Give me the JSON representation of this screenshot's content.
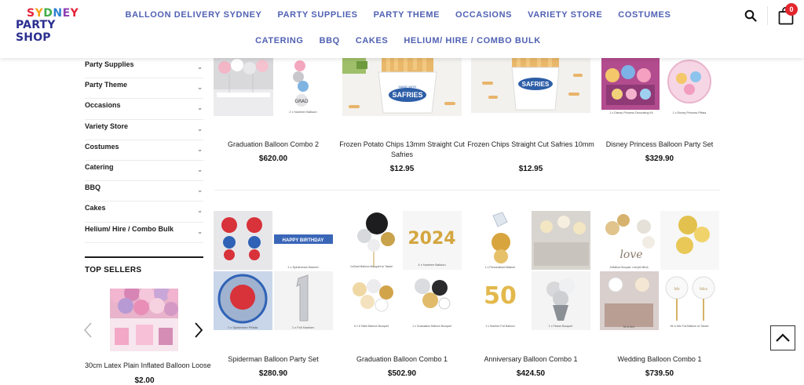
{
  "brand": {
    "line1_letters": [
      "S",
      "Y",
      "D",
      "N",
      "E",
      "Y"
    ],
    "line2": "PARTY SHOP"
  },
  "nav": {
    "items": [
      "Balloon Delivery Sydney",
      "Party Supplies",
      "Party Theme",
      "Occasions",
      "Variety Store",
      "Costumes",
      "Catering",
      "BBQ",
      "Cakes",
      "Helium/ Hire / Combo Bulk"
    ],
    "accent_color": "#5061b3"
  },
  "header": {
    "cart_count": "0"
  },
  "sidebar": {
    "categories": [
      "Party Supplies",
      "Party Theme",
      "Occasions",
      "Variety Store",
      "Costumes",
      "Catering",
      "BBQ",
      "Cakes",
      "Helium/ Hire / Combo Bulk"
    ],
    "top_sellers_title": "TOP SELLERS",
    "top_seller": {
      "name": "30cm Latex Plain Inflated Balloon Loose",
      "price": "$2.00"
    }
  },
  "products": [
    {
      "name": "Graduation Balloon Combo 2",
      "price": "$620.00",
      "captions": [
        "2 x Number Balloon"
      ]
    },
    {
      "name": "Frozen Potato Chips 13mm Straight Cut Safries",
      "price": "$12.95",
      "captions": [
        "SAFRIES",
        "MADE WITH"
      ]
    },
    {
      "name": "Frozen Chips Straight Cut Safries 10mm",
      "price": "$12.95",
      "captions": [
        "SAFRIES"
      ]
    },
    {
      "name": "Disney Princess Balloon Party Set",
      "price": "$329.90",
      "captions": [
        "1 x Disney Princess Decorating Kit",
        "1 x Disney Princess Pifiata"
      ]
    },
    {
      "name": "Spiderman Balloon Party Set",
      "price": "$280.90",
      "captions": [
        "HAPPY BIRTHDAY",
        "1 x Spiderman Banner",
        "1 x Spiderman Piñata",
        "1 x Foil Number"
      ]
    },
    {
      "name": "Graduation Balloon Combo 1",
      "price": "$502.90",
      "captions": [
        "2024",
        "4 x Number Balloon",
        "1 x Graduation Balloon Bouquet",
        "1xGiant Balloon Bouquet w/ Tassel",
        "6 x 6 Table Balloon Bouquet"
      ]
    },
    {
      "name": "Anniversary Balloon Combo 1",
      "price": "$424.50",
      "captions": [
        "50",
        "1 x Number Foil Balloon",
        "1 x Flower Bouquet",
        "1 x Personalised Balloon"
      ]
    },
    {
      "name": "Wedding Balloon Combo 1",
      "price": "$739.50",
      "captions": [
        "love",
        "Mr & Mrs",
        "2xBalloon Bouquet; Love(Air-filled)",
        "Mr & Mrs Foil Balloon w/ Tassel"
      ]
    }
  ]
}
